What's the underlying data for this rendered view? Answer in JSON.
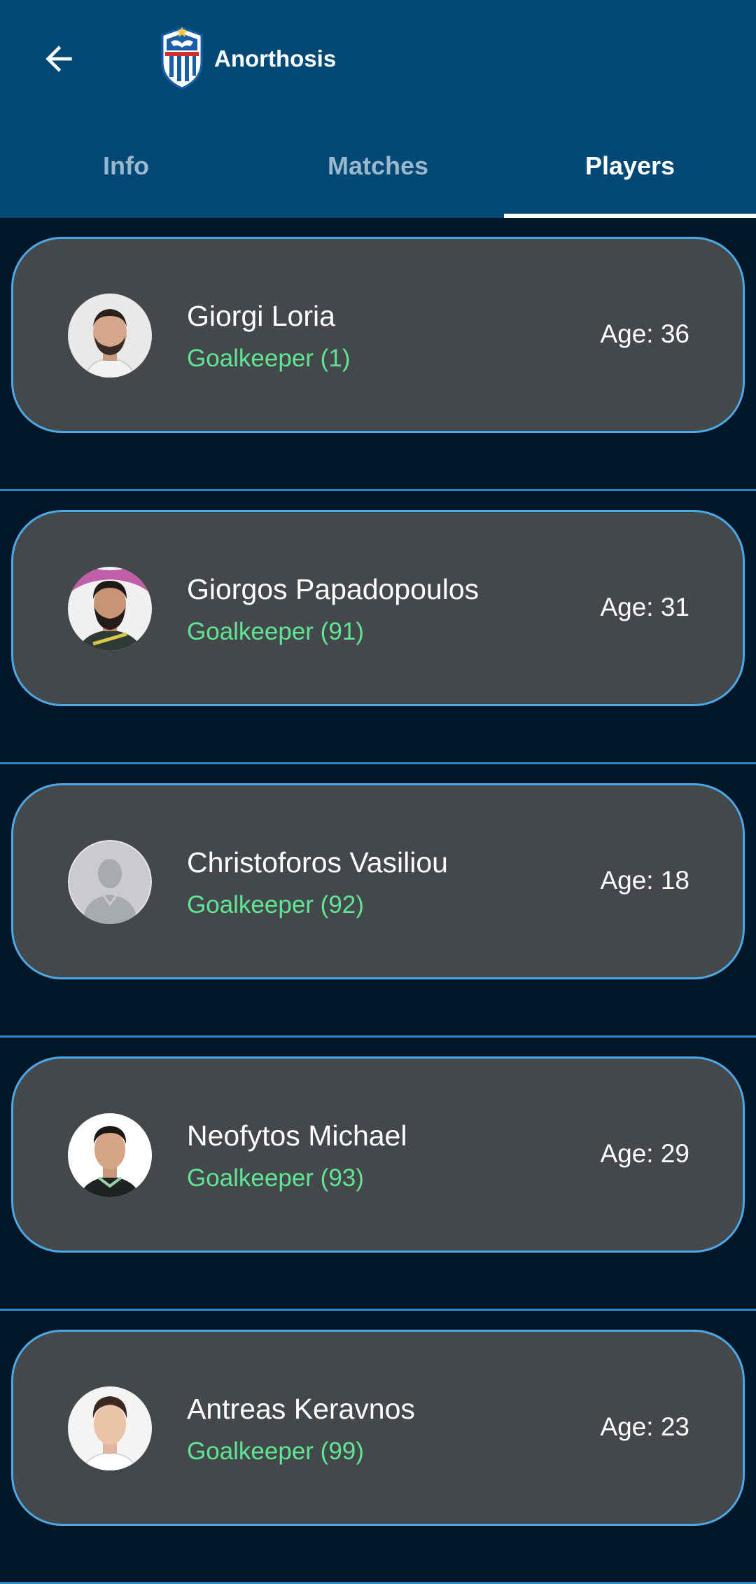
{
  "header": {
    "team_name": "Anorthosis",
    "back_icon": "arrow-left-icon",
    "crest_icon": "team-crest-icon"
  },
  "tabs": [
    {
      "label": "Info",
      "active": false
    },
    {
      "label": "Matches",
      "active": false
    },
    {
      "label": "Players",
      "active": true
    }
  ],
  "players": [
    {
      "name": "Giorgi Loria",
      "position": "Goalkeeper (1)",
      "age": "Age: 36"
    },
    {
      "name": "Giorgos Papadopoulos",
      "position": "Goalkeeper (91)",
      "age": "Age: 31"
    },
    {
      "name": "Christoforos Vasiliou",
      "position": "Goalkeeper (92)",
      "age": "Age: 18"
    },
    {
      "name": "Neofytos Michael",
      "position": "Goalkeeper (93)",
      "age": "Age: 29"
    },
    {
      "name": "Antreas Keravnos",
      "position": "Goalkeeper (99)",
      "age": "Age: 23"
    }
  ],
  "colors": {
    "appbar": "#004977",
    "background": "#011627",
    "card": "#45484b",
    "card_border": "#4ba8e6",
    "position_text": "#5ee695",
    "divider": "#2f87c6"
  }
}
